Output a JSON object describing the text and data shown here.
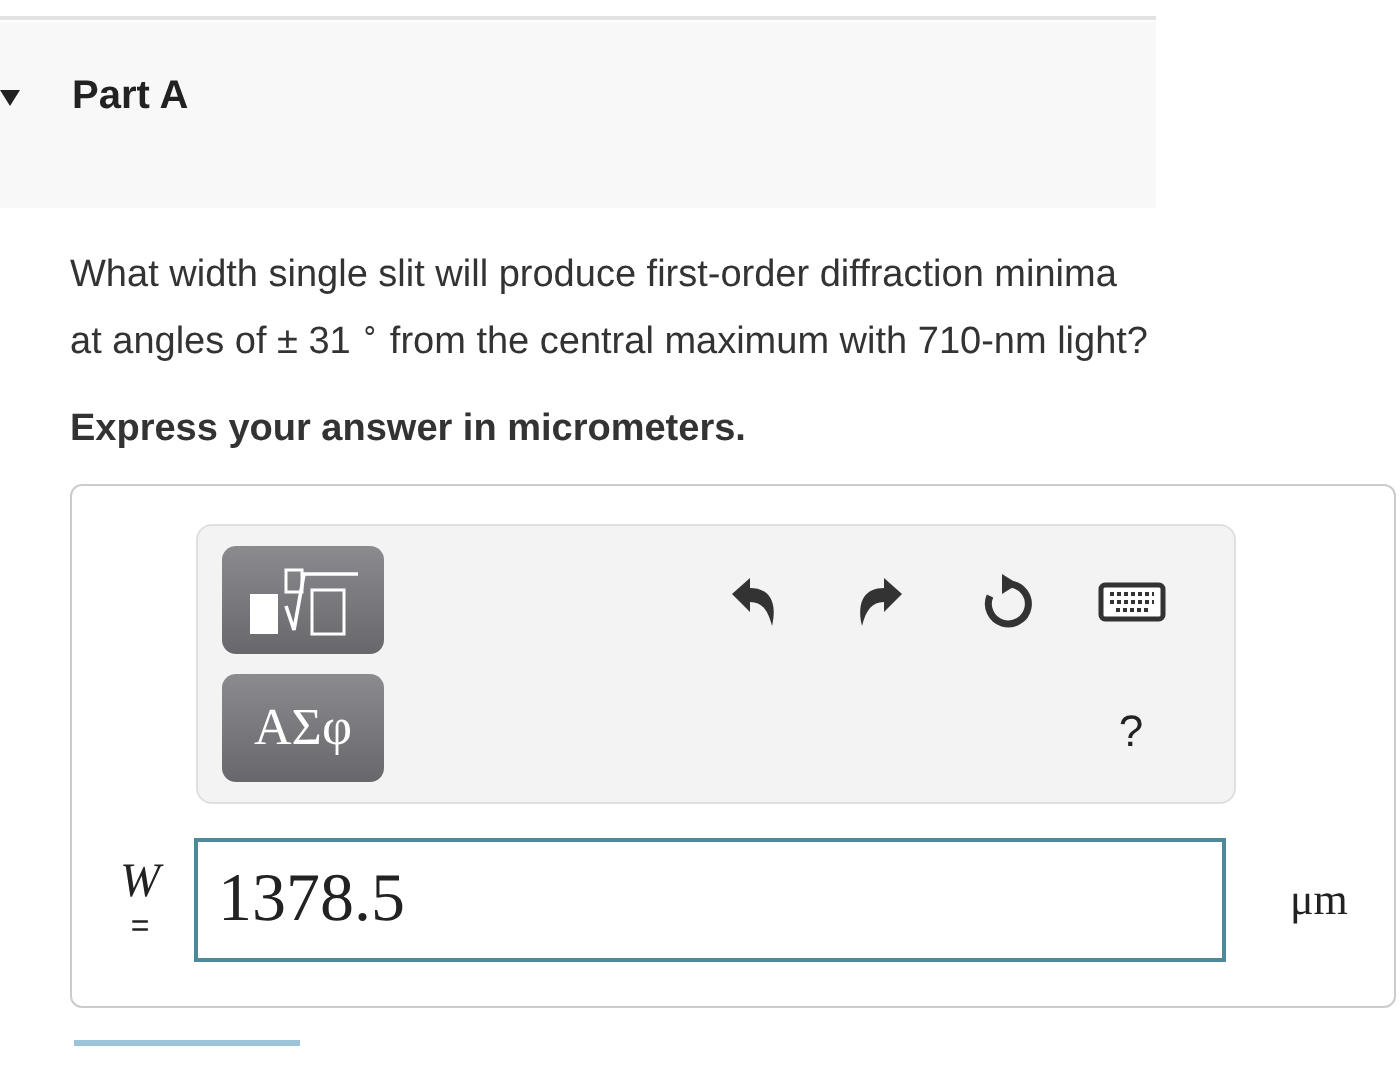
{
  "part": {
    "title": "Part A",
    "expanded": true
  },
  "question": "What width single slit will produce first-order diffraction minima at angles of ± 31 $^{∘}$ from the central maximum with 710-nm light?",
  "instruction": "Express your answer in micrometers.",
  "toolbar": {
    "symbols_button": "ΑΣφ",
    "help": "?"
  },
  "answer": {
    "variable": "W",
    "equals": "=",
    "value": "1378.5",
    "unit": "μm"
  }
}
